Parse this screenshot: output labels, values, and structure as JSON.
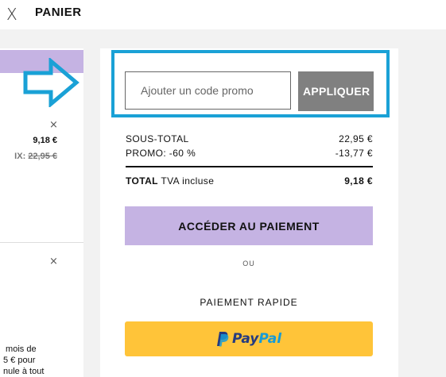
{
  "header": {
    "close_glyph": "X",
    "title": "PANIER"
  },
  "left_panel": {
    "close_glyph": "×",
    "price": "9,18 €",
    "old_price_prefix": "IX: ",
    "old_price_value": "22,95 €",
    "close_glyph_2": "×",
    "promo_text": " mois de\n5 € pour\nnule à tout"
  },
  "arrow_icon": "right-arrow-icon",
  "promo": {
    "placeholder": "Ajouter un code promo",
    "value": "",
    "apply_label": "APPLIQUER"
  },
  "summary": {
    "subtotal_label": "SOUS-TOTAL",
    "subtotal_value": "22,95 €",
    "promo_label": "PROMO: -60 %",
    "promo_value": "-13,77 €",
    "total_label_bold": "TOTAL",
    "total_label_rest": " TVA incluse",
    "total_value": "9,18 €"
  },
  "checkout": {
    "pay_label": "ACCÉDER AU PAIEMENT",
    "or_label": "OU",
    "express_label": "PAIEMENT RAPIDE",
    "paypal_pay": "Pay",
    "paypal_pal": "Pal"
  },
  "colors": {
    "accent": "#c5b3e3",
    "highlight": "#1aa1d6",
    "button_grey": "#808080",
    "paypal_yellow": "#ffc439"
  }
}
